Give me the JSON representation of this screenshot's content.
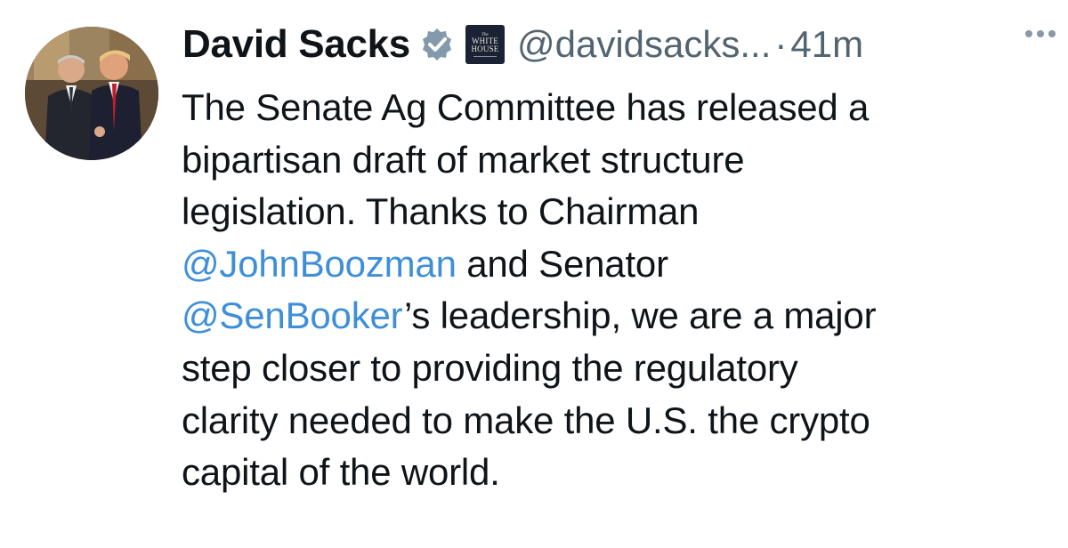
{
  "tweet": {
    "author": {
      "display_name": "David Sacks",
      "verified_icon": "verified-badge-icon",
      "affiliation_badge": {
        "small": "The",
        "line1": "WHITE",
        "line2": "HOUSE"
      },
      "handle": "@davidsacks...",
      "avatar_icon": "profile-photo"
    },
    "separator": "·",
    "time": "41m",
    "more_icon": "more-options-icon",
    "body": {
      "line1": "The Senate Ag Committee has released a",
      "line2": "bipartisan draft of market structure",
      "line3": "legislation. Thanks to Chairman",
      "mention1": "@JohnBoozman",
      "line4_rest": " and Senator",
      "mention2": "@SenBooker",
      "line5_rest": "’s leadership, we are a major",
      "line6": "step closer to providing the regulatory",
      "line7": "clarity needed to make the U.S. the crypto",
      "line8": "capital of the world."
    }
  },
  "colors": {
    "text": "#0f1419",
    "secondary": "#536471",
    "mention": "#3f8fd8",
    "verified": "#829aab",
    "badge_bg": "#1b2234"
  }
}
